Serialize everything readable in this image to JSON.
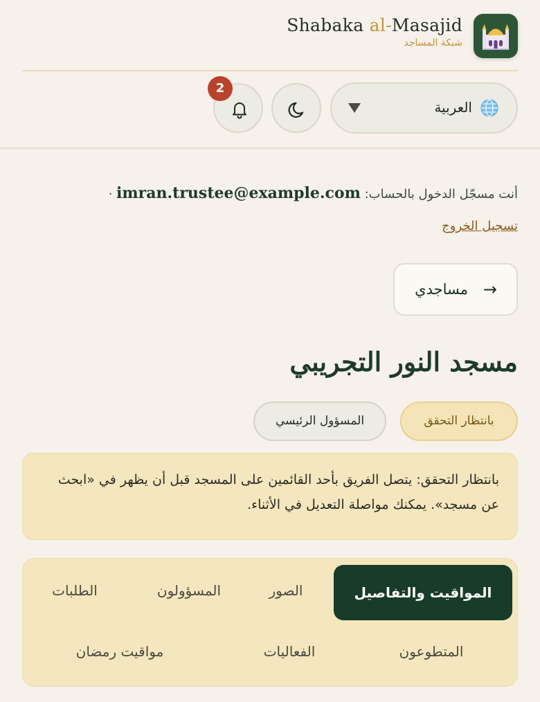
{
  "brand": {
    "name_prefix": "Shabaka ",
    "name_accent": "al-",
    "name_suffix": "Masajid",
    "subtitle": "شبكة المساجد",
    "logo_icon": "mosque-icon"
  },
  "controls": {
    "language_label": "العربية",
    "language_icon": "globe-icon",
    "theme_icon": "moon-icon",
    "notifications_icon": "bell-icon",
    "notifications_count": "2"
  },
  "account": {
    "signed_in_prefix": "أنت مسجّل الدخول بالحساب:",
    "email": "imran.trustee@example.com",
    "separator": "·",
    "logout_label": "تسجيل الخروج"
  },
  "back": {
    "arrow": "→",
    "label": "مساجدي"
  },
  "mosque": {
    "title": "مسجد النور التجريبي",
    "status_badge": "بانتظار التحقق",
    "role_badge": "المسؤول الرئيسي"
  },
  "notice": {
    "text": "بانتظار التحقق: يتصل الفريق بأحد القائمين على المسجد قبل أن يظهر في «ابحث عن مسجد». يمكنك مواصلة التعديل في الأثناء."
  },
  "tabs": {
    "row1": [
      "المواقيت والتفاصيل",
      "الصور",
      "المسؤولون",
      "الطلبات"
    ],
    "row2": [
      "المتطوعون",
      "الفعاليات",
      "مواقيت رمضان"
    ],
    "active_index": 0
  },
  "colors": {
    "background": "#f6f1ea",
    "accent_gold": "#c2943a",
    "primary_green": "#193b2a",
    "badge_red": "#b8432c",
    "notice_bg": "#f4e6be"
  }
}
